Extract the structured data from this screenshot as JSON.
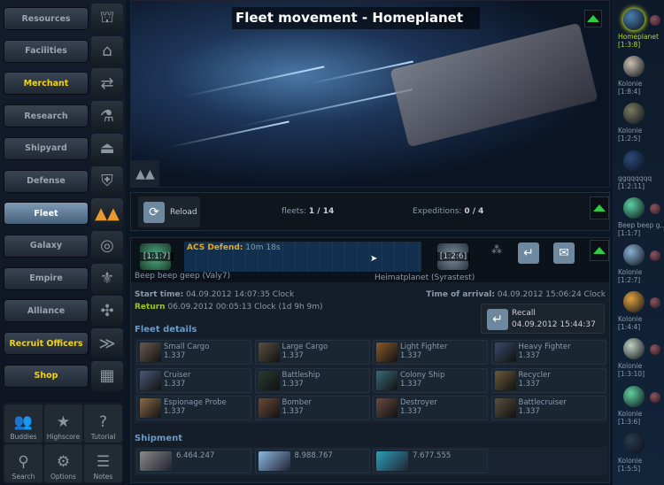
{
  "nav": [
    {
      "label": "Resources",
      "icon": "resources-icon",
      "glyph": "⛫",
      "style": ""
    },
    {
      "label": "Facilities",
      "icon": "facilities-icon",
      "glyph": "⌂",
      "style": ""
    },
    {
      "label": "Merchant",
      "icon": "merchant-icon",
      "glyph": "⇄",
      "style": "yellow"
    },
    {
      "label": "Research",
      "icon": "research-icon",
      "glyph": "⚗",
      "style": ""
    },
    {
      "label": "Shipyard",
      "icon": "shipyard-icon",
      "glyph": "⏏",
      "style": ""
    },
    {
      "label": "Defense",
      "icon": "defense-icon",
      "glyph": "⛨",
      "style": ""
    },
    {
      "label": "Fleet",
      "icon": "fleet-icon",
      "glyph": "▲▲",
      "style": "active"
    },
    {
      "label": "Galaxy",
      "icon": "galaxy-icon",
      "glyph": "◎",
      "style": ""
    },
    {
      "label": "Empire",
      "icon": "empire-icon",
      "glyph": "⚜",
      "style": ""
    },
    {
      "label": "Alliance",
      "icon": "alliance-icon",
      "glyph": "✣",
      "style": ""
    },
    {
      "label": "Recruit Officers",
      "icon": "officers-icon",
      "glyph": "≫",
      "style": "yellow"
    },
    {
      "label": "Shop",
      "icon": "shop-icon",
      "glyph": "▦",
      "style": "yellow"
    }
  ],
  "tools": [
    {
      "label": "Buddies",
      "icon": "buddies-icon",
      "glyph": "👥"
    },
    {
      "label": "Highscore",
      "icon": "highscore-icon",
      "glyph": "★"
    },
    {
      "label": "Tutorial",
      "icon": "tutorial-icon",
      "glyph": "?"
    },
    {
      "label": "Search",
      "icon": "search-icon",
      "glyph": "⚲"
    },
    {
      "label": "Options",
      "icon": "options-icon",
      "glyph": "⚙"
    },
    {
      "label": "Notes",
      "icon": "notes-icon",
      "glyph": "☰"
    }
  ],
  "header": {
    "title": "Fleet movement - Homeplanet"
  },
  "toolbar": {
    "reload": "Reload",
    "fleets_label": "fleets:",
    "fleets_value": "1 / 14",
    "expeditions_label": "Expeditions:",
    "expeditions_value": "0 / 4"
  },
  "mission": {
    "origin_coords": "[1:1:7]",
    "origin_name": "Beep beep geep (Valy7)",
    "type": "ACS Defend:",
    "countdown": "10m 18s",
    "dest_coords": "[1:2:6]",
    "dest_name": "Heimatplanet (Syrastest)",
    "start_label": "Start time:",
    "start_value": "04.09.2012 14:07:35 Clock",
    "arrival_label": "Time of arrival:",
    "arrival_value": "04.09.2012 15:06:24 Clock",
    "return_label": "Return",
    "return_value": "06.09.2012 00:05:13 Clock (1d 9h 9m)",
    "recall_label": "Recall",
    "recall_time": "04.09.2012 15:44:37"
  },
  "fleet_details": {
    "title": "Fleet details",
    "ships": [
      {
        "name": "Small Cargo",
        "count": "1.337",
        "color": "#6a5a50"
      },
      {
        "name": "Large Cargo",
        "count": "1.337",
        "color": "#5a5040"
      },
      {
        "name": "Light Fighter",
        "count": "1.337",
        "color": "#8a5a2a"
      },
      {
        "name": "Heavy Fighter",
        "count": "1.337",
        "color": "#3a4a6a"
      },
      {
        "name": "Cruiser",
        "count": "1.337",
        "color": "#4a5a7a"
      },
      {
        "name": "Battleship",
        "count": "1.337",
        "color": "#2a3a30"
      },
      {
        "name": "Colony Ship",
        "count": "1.337",
        "color": "#3a6a7a"
      },
      {
        "name": "Recycler",
        "count": "1.337",
        "color": "#6a5a3a"
      },
      {
        "name": "Espionage Probe",
        "count": "1.337",
        "color": "#8a6a4a"
      },
      {
        "name": "Bomber",
        "count": "1.337",
        "color": "#6a4a3a"
      },
      {
        "name": "Destroyer",
        "count": "1.337",
        "color": "#6a4a40"
      },
      {
        "name": "Battlecruiser",
        "count": "1.337",
        "color": "#5a5040"
      }
    ]
  },
  "shipment": {
    "title": "Shipment",
    "items": [
      {
        "resource": "metal",
        "amount": "6.464.247",
        "color": "#8a8a88"
      },
      {
        "resource": "crystal",
        "amount": "8.988.767",
        "color": "#8ab8e0"
      },
      {
        "resource": "deuterium",
        "amount": "7.677.555",
        "color": "#2aa0b8"
      }
    ]
  },
  "planets": [
    {
      "name": "Homeplanet",
      "coords": "[1:3:8]",
      "color": "#4a80b0",
      "moon": true,
      "selected": true
    },
    {
      "name": "Kolonie",
      "coords": "[1:8:4]",
      "color": "#c8c0b0",
      "moon": false
    },
    {
      "name": "Kolonie",
      "coords": "[1:2:5]",
      "color": "#7a7a60",
      "moon": false
    },
    {
      "name": "ggqqqqqq",
      "coords": "[1:2:11]",
      "color": "#2a4a7a",
      "moon": false
    },
    {
      "name": "Beep beep g...",
      "coords": "[1:1:7]",
      "color": "#5ad0a0",
      "moon": true
    },
    {
      "name": "Kolonie",
      "coords": "[1:2:7]",
      "color": "#8ab0d0",
      "moon": true
    },
    {
      "name": "Kolonie",
      "coords": "[1:4:4]",
      "color": "#e0a040",
      "moon": true
    },
    {
      "name": "Kolonie",
      "coords": "[1:3:10]",
      "color": "#c0d0c0",
      "moon": true
    },
    {
      "name": "Kolonie",
      "coords": "[1:3:6]",
      "color": "#60d0a0",
      "moon": true
    },
    {
      "name": "Kolonie",
      "coords": "[1:5:5]",
      "color": "#2a3a50",
      "moon": false
    }
  ]
}
